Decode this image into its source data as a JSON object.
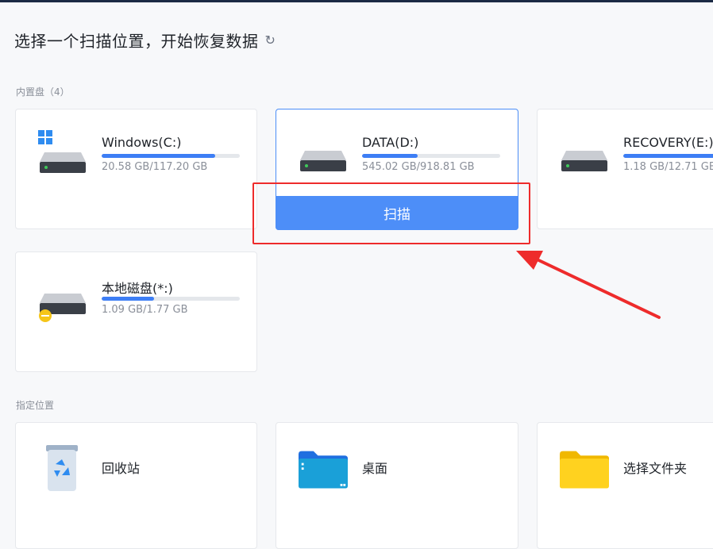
{
  "header": {
    "title": "选择一个扫描位置，开始恢复数据",
    "refresh_icon": "refresh-icon"
  },
  "internal_disks": {
    "label": "内置盘（4）",
    "drives": [
      {
        "name": "Windows(C:)",
        "size": "20.58 GB/117.20 GB",
        "used_fraction": 0.82
      },
      {
        "name": "DATA(D:)",
        "size": "545.02 GB/918.81 GB",
        "used_fraction": 0.4,
        "scan_label": "扫描"
      },
      {
        "name": "RECOVERY(E:)",
        "size": "1.18 GB/12.71 GB",
        "used_fraction": 0.95
      },
      {
        "name": "本地磁盘(*:)",
        "size": "1.09 GB/1.77 GB",
        "used_fraction": 0.38
      }
    ]
  },
  "specified_locations": {
    "label": "指定位置",
    "items": [
      {
        "name": "回收站",
        "icon": "recycle-bin-icon"
      },
      {
        "name": "桌面",
        "icon": "desktop-folder-icon"
      },
      {
        "name": "选择文件夹",
        "icon": "folder-icon"
      }
    ]
  },
  "colors": {
    "accent": "#4d8ef8",
    "highlight": "#ee2b2b"
  }
}
